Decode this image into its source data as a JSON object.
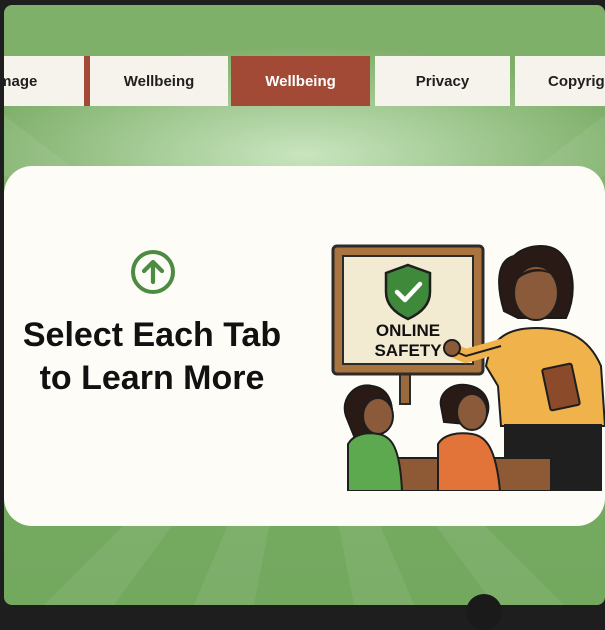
{
  "tabs": [
    {
      "label": "Image",
      "state": "clipped-left"
    },
    {
      "label": "Wellbeing",
      "state": "normal"
    },
    {
      "label": "Wellbeing",
      "state": "active"
    },
    {
      "label": "Privacy",
      "state": "normal"
    },
    {
      "label": "Copyrig",
      "state": "clipped-right"
    }
  ],
  "card": {
    "heading_line1": "Select Each Tab",
    "heading_line2": "to Learn More",
    "icon": "arrow-up-circle-icon"
  },
  "illustration": {
    "sign_line1": "ONLINE",
    "sign_line2": "SAFETY",
    "sign_icon": "shield-check-icon"
  },
  "colors": {
    "accent": "#a24a35",
    "background_green": "#7fb06a",
    "icon_green": "#4d8a42",
    "tab_bg": "#f6f3ec",
    "card_bg": "#fdfcf7"
  }
}
